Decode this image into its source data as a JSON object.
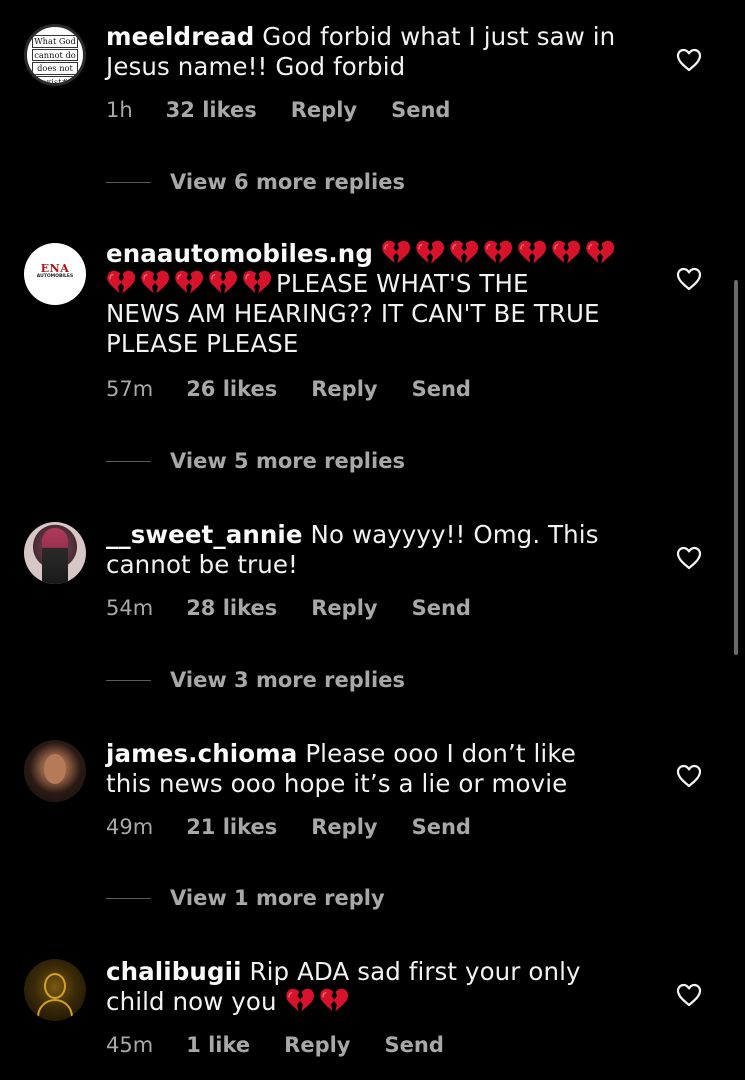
{
  "colors": {
    "background": "#000000",
    "text": "#f2f2f2",
    "meta": "#a8a8a8",
    "heartbreak": "#e0142d"
  },
  "comments": [
    {
      "username": "meeldread",
      "text": "God forbid what I just saw in Jesus name!! God forbid",
      "time": "1h",
      "likes": "32 likes",
      "reply": "Reply",
      "send": "Send",
      "view_replies": "View 6 more replies",
      "avatar_text": [
        "What God",
        "cannot do",
        "does not",
        "exist#"
      ]
    },
    {
      "username": "enaautomobiles.ng",
      "text_emoji_count_line1": 7,
      "text_emoji_count_line2": 5,
      "text": "PLEASE WHAT'S THE NEWS AM HEARING?? IT CAN'T BE TRUE PLEASE PLEASE",
      "text_line2": "PLEASE WHAT'S THE",
      "text_line3": "NEWS AM HEARING?? IT CAN'T BE TRUE",
      "text_line4": "PLEASE PLEASE",
      "time": "57m",
      "likes": "26 likes",
      "reply": "Reply",
      "send": "Send",
      "view_replies": "View 5 more replies",
      "avatar_logo": "ENA",
      "avatar_sub": "AUTOMOBILES"
    },
    {
      "username": "__sweet_annie",
      "text": "No wayyyy!! Omg. This cannot be true!",
      "time": "54m",
      "likes": "28 likes",
      "reply": "Reply",
      "send": "Send",
      "view_replies": "View 3 more replies"
    },
    {
      "username": "james.chioma",
      "text": "Please ooo I don’t like this news ooo hope it’s a lie or movie",
      "time": "49m",
      "likes": "21 likes",
      "reply": "Reply",
      "send": "Send",
      "view_replies": "View 1 more reply"
    },
    {
      "username": "chalibugii",
      "text": "Rip ADA sad first your only child now you",
      "time": "45m",
      "likes": "1 like",
      "reply": "Reply",
      "send": "Send"
    }
  ],
  "icons": {
    "like": "heart-outline-icon",
    "emoji": "broken-heart-icon"
  }
}
